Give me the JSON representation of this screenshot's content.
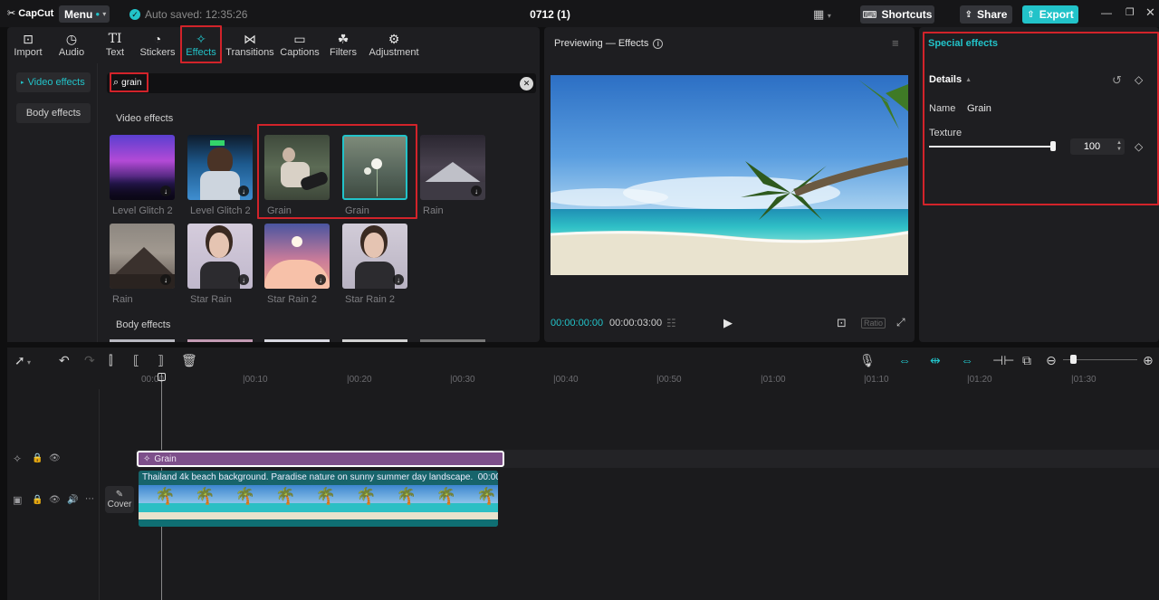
{
  "app": {
    "logo": "CapCut",
    "menu_label": "Menu",
    "autosave": "Auto saved: 12:35:26",
    "project_title": "0712 (1)"
  },
  "titlebar": {
    "shortcuts": "Shortcuts",
    "share": "Share",
    "export": "Export"
  },
  "tabs": [
    {
      "label": "Import",
      "icon": "import-icon"
    },
    {
      "label": "Audio",
      "icon": "audio-icon"
    },
    {
      "label": "Text",
      "icon": "text-icon"
    },
    {
      "label": "Stickers",
      "icon": "stickers-icon"
    },
    {
      "label": "Effects",
      "icon": "effects-icon",
      "active": true
    },
    {
      "label": "Transitions",
      "icon": "transitions-icon"
    },
    {
      "label": "Captions",
      "icon": "captions-icon"
    },
    {
      "label": "Filters",
      "icon": "filters-icon"
    },
    {
      "label": "Adjustment",
      "icon": "adjustment-icon"
    }
  ],
  "sidenav": {
    "video_effects": "Video effects",
    "body_effects": "Body effects"
  },
  "search": {
    "value": "grain"
  },
  "sections": {
    "video_effects": "Video effects",
    "body_effects": "Body effects"
  },
  "effects": [
    {
      "label": "Level Glitch 2"
    },
    {
      "label": "Level Glitch 2"
    },
    {
      "label": "Grain"
    },
    {
      "label": "Grain"
    },
    {
      "label": "Rain"
    },
    {
      "label": "Rain"
    },
    {
      "label": "Star Rain"
    },
    {
      "label": "Star Rain 2"
    },
    {
      "label": "Star Rain 2"
    }
  ],
  "preview": {
    "title": "Previewing — Effects",
    "current_time": "00:00:00:00",
    "duration": "00:00:03:00",
    "ratio": "Ratio"
  },
  "props": {
    "title": "Special effects",
    "details": "Details",
    "name_label": "Name",
    "name_value": "Grain",
    "texture_label": "Texture",
    "texture_value": "100",
    "texture_level": 1.0
  },
  "timeline": {
    "ticks": [
      "00:00",
      "|00:10",
      "|00:20",
      "|00:30",
      "|00:40",
      "|00:50",
      "|01:00",
      "|01:10",
      "|01:20",
      "|01:30"
    ],
    "effect_clip": "Grain",
    "video_clip": "Thailand 4k beach background. Paradise nature on sunny summer day landscape.",
    "video_clip_time": "00:00:",
    "cover_label": "Cover"
  },
  "colors": {
    "accent": "#22c3c9",
    "effect_clip": "#7d4f8a",
    "highlight_box": "#d2232a"
  }
}
